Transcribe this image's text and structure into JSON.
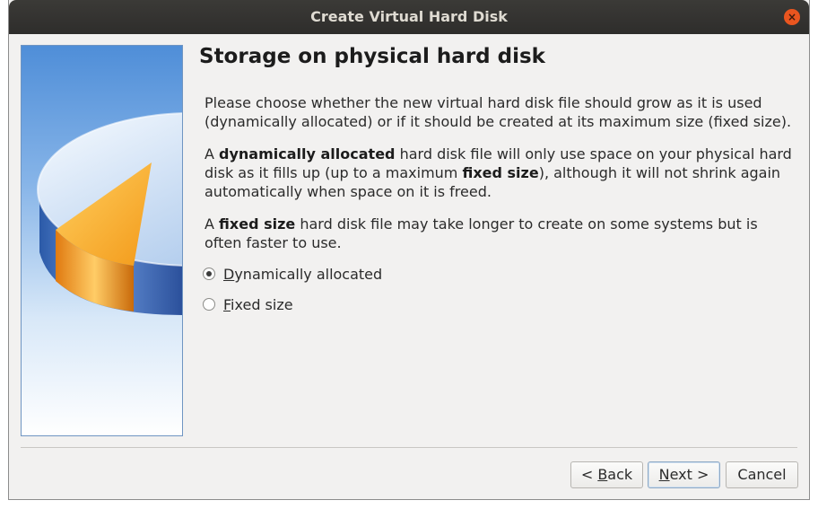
{
  "window": {
    "title": "Create Virtual Hard Disk",
    "close_glyph": "×"
  },
  "page": {
    "heading": "Storage on physical hard disk",
    "para1": "Please choose whether the new virtual hard disk file should grow as it is used (dynamically allocated) or if it should be created at its maximum size (fixed size).",
    "para2": {
      "p1": "A ",
      "b1": "dynamically allocated",
      "p2": " hard disk file will only use space on your physical hard disk as it fills up (up to a maximum ",
      "b2": "fixed size",
      "p3": "), although it will not shrink again automatically when space on it is freed."
    },
    "para3": {
      "p1": "A ",
      "b1": "fixed size",
      "p2": " hard disk file may take longer to create on some systems but is often faster to use."
    }
  },
  "options": {
    "dynamic": {
      "mnemonic": "D",
      "rest": "ynamically allocated",
      "checked": true
    },
    "fixed": {
      "mnemonic": "F",
      "rest": "ixed size",
      "checked": false
    }
  },
  "buttons": {
    "back": {
      "prefix": "< ",
      "mnemonic": "B",
      "rest": "ack"
    },
    "next": {
      "prefix": "",
      "mnemonic": "N",
      "rest": "ext >"
    },
    "cancel": {
      "label": "Cancel"
    }
  },
  "colors": {
    "titlebar": "#2e2d2b",
    "close": "#e9551f",
    "dialog_bg": "#f2f1f0"
  }
}
